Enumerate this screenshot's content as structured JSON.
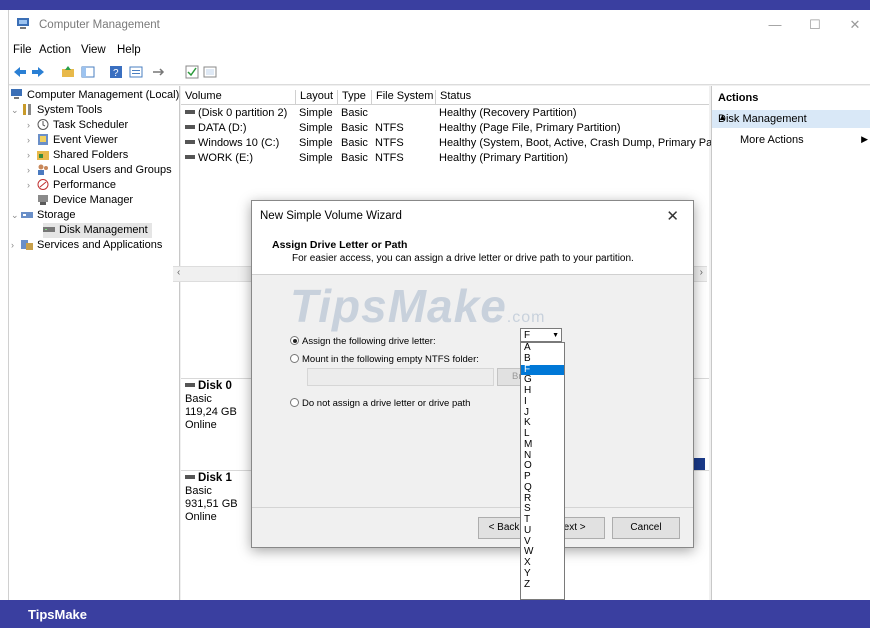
{
  "window": {
    "title": "Computer Management"
  },
  "menu": [
    "File",
    "Action",
    "View",
    "Help"
  ],
  "tree": [
    {
      "label": "Computer Management (Local)",
      "expander": ""
    },
    {
      "label": "System Tools",
      "expander": "⌄"
    },
    {
      "label": "Task Scheduler",
      "expander": "›"
    },
    {
      "label": "Event Viewer",
      "expander": "›"
    },
    {
      "label": "Shared Folders",
      "expander": "›"
    },
    {
      "label": "Local Users and Groups",
      "expander": "›"
    },
    {
      "label": "Performance",
      "expander": "›"
    },
    {
      "label": "Device Manager",
      "expander": ""
    },
    {
      "label": "Storage",
      "expander": "⌄"
    },
    {
      "label": "Disk Management",
      "expander": ""
    },
    {
      "label": "Services and Applications",
      "expander": "›"
    }
  ],
  "volumes": {
    "headers": [
      "Volume",
      "Layout",
      "Type",
      "File System",
      "Status"
    ],
    "rows": [
      [
        "(Disk 0 partition 2)",
        "Simple",
        "Basic",
        "",
        "Healthy (Recovery Partition)"
      ],
      [
        "DATA (D:)",
        "Simple",
        "Basic",
        "NTFS",
        "Healthy (Page File, Primary Partition)"
      ],
      [
        "Windows 10 (C:)",
        "Simple",
        "Basic",
        "NTFS",
        "Healthy (System, Boot, Active, Crash Dump, Primary Partit"
      ],
      [
        "WORK (E:)",
        "Simple",
        "Basic",
        "NTFS",
        "Healthy (Primary Partition)"
      ]
    ]
  },
  "disks": [
    {
      "name": "Disk 0",
      "type": "Basic",
      "size": "119,24 GB",
      "state": "Online"
    },
    {
      "name": "Disk 1",
      "type": "Basic",
      "size": "931,51 GB",
      "state": "Online"
    }
  ],
  "actions": {
    "header": "Actions",
    "selected": "Disk Management",
    "more": "More Actions"
  },
  "dialog": {
    "title": "New Simple Volume Wizard",
    "heading": "Assign Drive Letter or Path",
    "subheading": "For easier access, you can assign a drive letter or drive path to your partition.",
    "opt_assign": "Assign the following drive letter:",
    "opt_mount": "Mount in the following empty NTFS folder:",
    "opt_none": "Do not assign a drive letter or drive path",
    "browse": "Br",
    "back": "< Back",
    "next": "Next >",
    "cancel": "Cancel",
    "selected_letter": "F",
    "letters": [
      "A",
      "B",
      "F",
      "G",
      "H",
      "I",
      "J",
      "K",
      "L",
      "M",
      "N",
      "O",
      "P",
      "Q",
      "R",
      "S",
      "T",
      "U",
      "V",
      "W",
      "X",
      "Y",
      "Z"
    ],
    "watermark": "TipsMake",
    "watermark_suffix": ".com"
  },
  "footer": {
    "brand": "TipsMake"
  }
}
